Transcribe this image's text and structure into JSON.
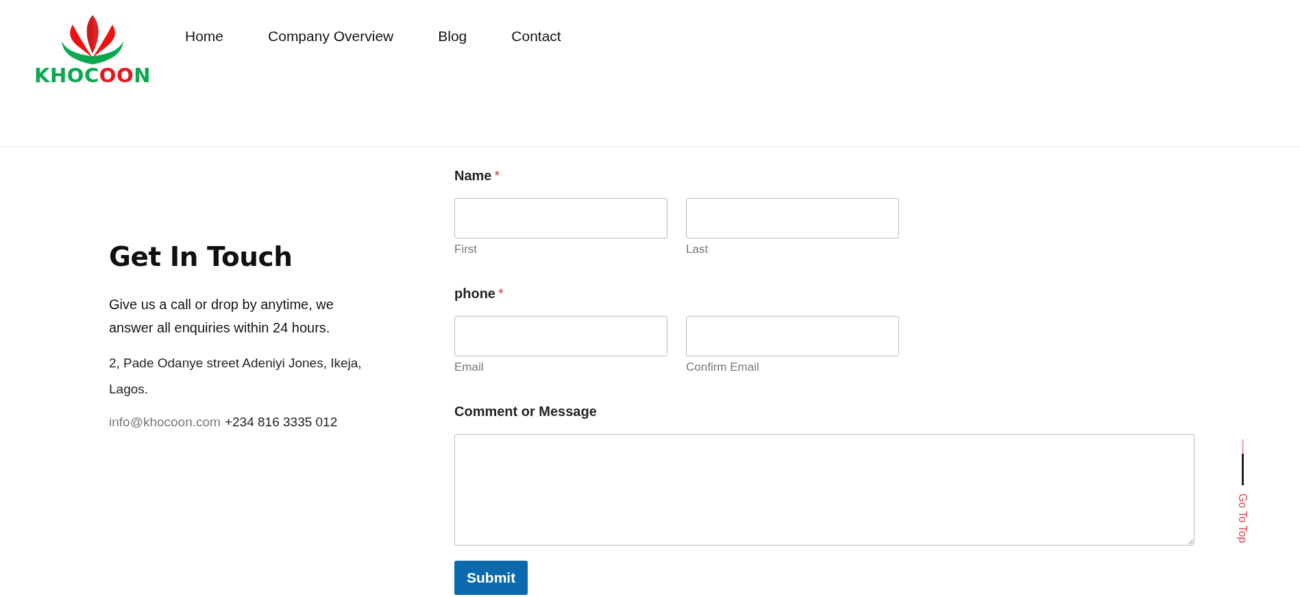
{
  "header": {
    "logo_text": "KHOCOON",
    "nav": [
      {
        "label": "Home"
      },
      {
        "label": "Company Overview"
      },
      {
        "label": "Blog"
      },
      {
        "label": "Contact"
      }
    ]
  },
  "contact_info": {
    "title": "Get In Touch",
    "description": "Give us a call or drop by anytime, we answer all enquiries within 24 hours.",
    "address": "2, Pade Odanye street Adeniyi Jones, Ikeja, Lagos.",
    "email": "info@khocoon.com",
    "phone": "+234 816 3335 012"
  },
  "form": {
    "fields": [
      {
        "kind": "pair",
        "label": "Name",
        "required_mark": "*",
        "inputs": [
          {
            "sublabel": "First"
          },
          {
            "sublabel": "Last"
          }
        ]
      },
      {
        "kind": "pair",
        "label": "phone",
        "required_mark": "*",
        "inputs": [
          {
            "sublabel": "Email"
          },
          {
            "sublabel": "Confirm Email"
          }
        ]
      },
      {
        "kind": "textarea",
        "label": "Comment or Message"
      }
    ],
    "submit": "Submit"
  },
  "go_to_top": "Go To Top"
}
